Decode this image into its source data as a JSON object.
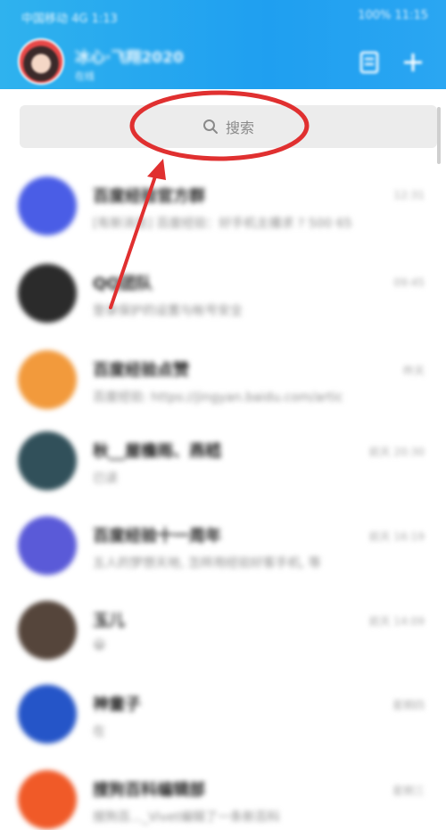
{
  "status_bar": {
    "left": "中国移动 4G 1:13",
    "right": "100% 11:15"
  },
  "header": {
    "nickname": "冰心·飞翔2020",
    "online_status": "在线",
    "contacts_icon": "contacts-icon",
    "add_icon": "plus-icon"
  },
  "search": {
    "placeholder": "搜索",
    "icon": "search-icon"
  },
  "annotation": {
    "color": "#e03030"
  },
  "chats": [
    {
      "name": "百度经验官方群",
      "message": "[有新消息] 百度经验：好手机主播求 ? 500 65",
      "time": "12:31",
      "avatar_color": "#4a5de6"
    },
    {
      "name": "QQ团队",
      "message": "登录保护的设置与帐号安全",
      "time": "09:45",
      "avatar_color": "#2b2b2b"
    },
    {
      "name": "百度经验点赞",
      "message": "百度经验: https://jingyan.baidu.com/artic",
      "time": "昨天",
      "avatar_color": "#f29a3c"
    },
    {
      "name": "秋__屋檐雨、燕嵇",
      "message": "已读",
      "time": "前天 20:30",
      "avatar_color": "#31505a"
    },
    {
      "name": "百度经验十一周年",
      "message": "五人的梦想天地, 怎样用经验好客手机, 等",
      "time": "前天 16:19",
      "avatar_color": "#5a5ad8"
    },
    {
      "name": "玉儿",
      "message": "😀",
      "time": "前天 14:09",
      "avatar_color": "#55453b"
    },
    {
      "name": "神童子",
      "message": "在",
      "time": "星期四",
      "avatar_color": "#2555c8"
    },
    {
      "name": "搜狗百科编辑部",
      "message": "搜狗百..._Vivet编辑了一条新百科",
      "time": "星期三",
      "avatar_color": "#f05a28"
    }
  ]
}
